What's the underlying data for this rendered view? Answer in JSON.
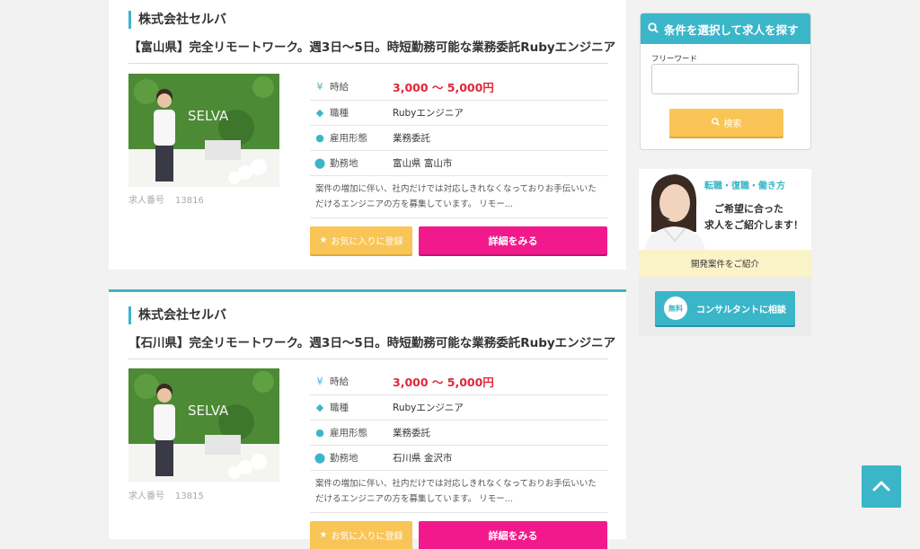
{
  "jobs": [
    {
      "company": "株式会社セルバ",
      "title": "【富山県】完全リモートワーク。週3日〜5日。時短勤務可能な業務委託Rubyエンジニア",
      "job_number_label": "求人番号",
      "job_number": "13816",
      "salary_label": "時給",
      "salary": "3,000 〜 5,000円",
      "occupation_label": "職種",
      "occupation": "Rubyエンジニア",
      "employment_label": "雇用形態",
      "employment": "業務委託",
      "location_label": "勤務地",
      "location": "富山県 富山市",
      "description": "案件の増加に伴い、社内だけでは対応しきれなくなっておりお手伝いいただけるエンジニアの方を募集しています。 リモー...",
      "favorite_label": "お気に入りに登録",
      "detail_label": "詳細をみる"
    },
    {
      "company": "株式会社セルバ",
      "title": "【石川県】完全リモートワーク。週3日〜5日。時短勤務可能な業務委託Rubyエンジニア",
      "job_number_label": "求人番号",
      "job_number": "13815",
      "salary_label": "時給",
      "salary": "3,000 〜 5,000円",
      "occupation_label": "職種",
      "occupation": "Rubyエンジニア",
      "employment_label": "雇用形態",
      "employment": "業務委託",
      "location_label": "勤務地",
      "location": "石川県 金沢市",
      "description": "案件の増加に伴い、社内だけでは対応しきれなくなっておりお手伝いいただけるエンジニアの方を募集しています。 リモー...",
      "favorite_label": "お気に入りに登録",
      "detail_label": "詳細をみる"
    }
  ],
  "photo_logo_text": "SELVA",
  "search": {
    "heading": "条件を選択して求人を探す",
    "freeword_label": "フリーワード",
    "freeword_value": "",
    "button_label": "検索"
  },
  "banner": {
    "tag": "転職・復職・働き方",
    "message_line1": "ご希望に合った",
    "message_line2": "求人をご紹介します！",
    "sub": "開発案件をご紹介",
    "free_badge": "無料",
    "consult_label": "コンサルタントに相談"
  },
  "icons": {
    "salary": "yen-icon",
    "occupation": "tag-icon",
    "employment": "person-icon",
    "location": "map-pin-icon",
    "favorite": "star-icon",
    "search": "search-icon",
    "top": "chevron-up-icon"
  },
  "colors": {
    "accent": "#3bb6c9",
    "detail_button": "#f1198c",
    "favorite_button": "#f9c557",
    "salary_text": "#e0263a"
  }
}
